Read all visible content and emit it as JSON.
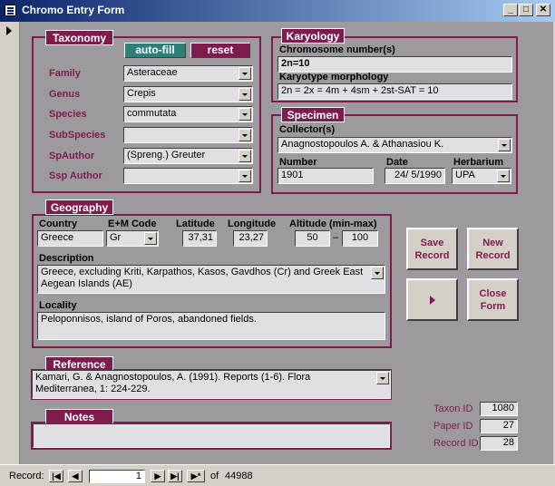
{
  "window": {
    "title": "Chromo Entry Form",
    "min": "_",
    "max": "□",
    "close": "✕"
  },
  "colors": {
    "accent": "#7f1b4f",
    "autofill": "#2e7f7a",
    "form_bg": "#9c9a9c",
    "field_bg": "#e0dfe3"
  },
  "taxonomy": {
    "title": "Taxonomy",
    "autofill_label": "auto-fill",
    "reset_label": "reset",
    "labels": {
      "family": "Family",
      "genus": "Genus",
      "species": "Species",
      "subspecies": "SubSpecies",
      "spauthor": "SpAuthor",
      "sspauthor": "Ssp Author"
    },
    "values": {
      "family": "Asteraceae",
      "genus": "Crepis",
      "species": "commutata",
      "subspecies": "",
      "spauthor": "(Spreng.) Greuter",
      "sspauthor": ""
    }
  },
  "karyology": {
    "title": "Karyology",
    "chromosome_label": "Chromosome number(s)",
    "chromosome_value": "2n=10",
    "morphology_label": "Karyotype morphology",
    "morphology_value": "2n = 2x = 4m + 4sm + 2st-SAT = 10"
  },
  "specimen": {
    "title": "Specimen",
    "collectors_label": "Collector(s)",
    "collectors_value": "Anagnostopoulos A. & Athanasiou K.",
    "number_label": "Number",
    "number_value": "1901",
    "date_label": "Date",
    "date_value": "24/ 5/1990",
    "herbarium_label": "Herbarium",
    "herbarium_value": "UPA"
  },
  "geography": {
    "title": "Geography",
    "country_label": "Country",
    "country_value": "Greece",
    "em_label": "E+M Code",
    "em_value": "Gr",
    "lat_label": "Latitude",
    "lat_value": "37,31",
    "lon_label": "Longitude",
    "lon_value": "23,27",
    "alt_label": "Altitude (min-max)",
    "alt_min": "50",
    "alt_sep": "–",
    "alt_max": "100",
    "description_label": "Description",
    "description_value": "Greece, excluding Kriti, Karpathos, Kasos, Gavdhos (Cr) and Greek East Aegean Islands (AE)",
    "locality_label": "Locality",
    "locality_value": "Peloponnisos, island of Poros, abandoned fields."
  },
  "actions": {
    "save": "Save Record",
    "new": "New Record",
    "close": "Close Form"
  },
  "reference": {
    "title": "Reference",
    "value": "Kamari, G. & Anagnostopoulos, A. (1991). Reports (1-6). Flora Mediterranea, 1: 224-229."
  },
  "notes": {
    "title": "Notes",
    "value": ""
  },
  "ids": {
    "taxon_label": "Taxon ID",
    "taxon_value": "1080",
    "paper_label": "Paper ID",
    "paper_value": "27",
    "record_label": "Record ID",
    "record_value": "28"
  },
  "navigation": {
    "record_label": "Record:",
    "current": "1",
    "of_label": "of",
    "total": "44988"
  }
}
